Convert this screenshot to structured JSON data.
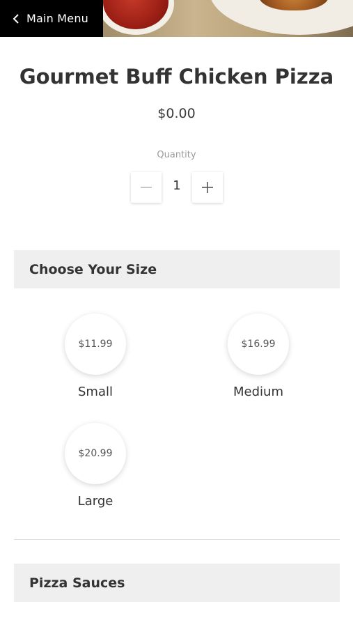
{
  "header": {
    "back_label": "Main Menu"
  },
  "product": {
    "title": "Gourmet Buff Chicken Pizza",
    "price": "$0.00"
  },
  "quantity": {
    "label": "Quantity",
    "value": "1"
  },
  "sections": {
    "size_title": "Choose Your Size",
    "sauce_title": "Pizza Sauces"
  },
  "sizes": [
    {
      "name": "Small",
      "price": "$11.99"
    },
    {
      "name": "Medium",
      "price": "$16.99"
    },
    {
      "name": "Large",
      "price": "$20.99"
    }
  ],
  "colors": {
    "back_button_bg": "#000000",
    "section_bg": "#efefef",
    "text": "#333333"
  }
}
